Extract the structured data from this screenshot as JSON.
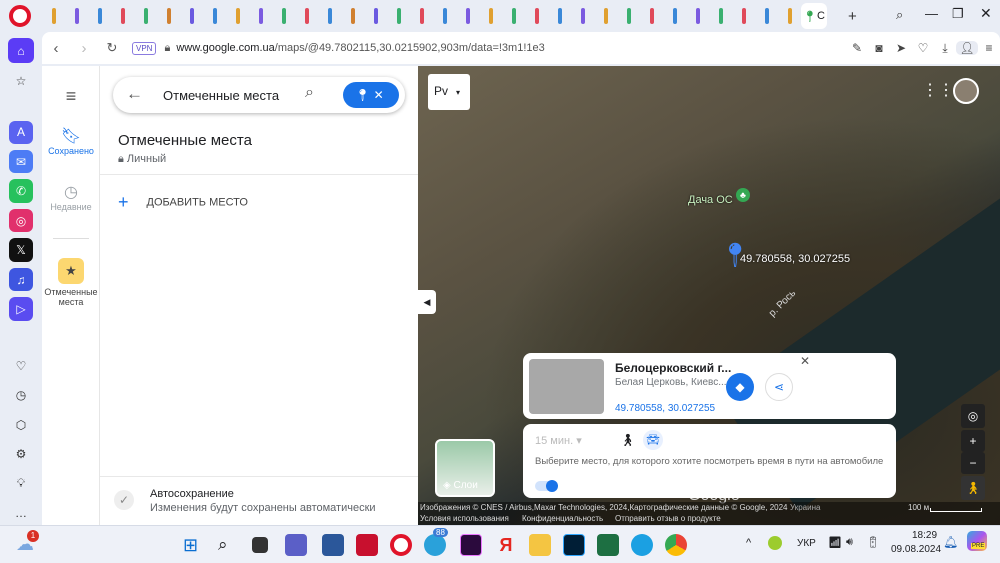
{
  "browser": {
    "active_tab_label": "C",
    "tab_colors": [
      "#e0a030",
      "#7b5be0",
      "#3a88d8",
      "#e04a5a",
      "#3ab070",
      "#d08030",
      "#6a5ae0",
      "#3a88d8",
      "#e0a030",
      "#7b5be0",
      "#3ab070",
      "#e04a5a",
      "#3a88d8",
      "#d08030",
      "#6a5ae0",
      "#3ab070",
      "#e04a5a",
      "#3a88d8",
      "#7b5be0",
      "#e0a030",
      "#3ab070",
      "#e04a5a",
      "#3a88d8",
      "#7b5be0",
      "#e0a030",
      "#3ab070",
      "#e04a5a",
      "#3a88d8",
      "#7b5be0",
      "#3ab070",
      "#e04a5a",
      "#3a88d8",
      "#e0a030"
    ],
    "vpn_label": "VPN",
    "url_domain": "www.google.com.ua",
    "url_path": "/maps/@49.7802115,30.0215902,903m/data=!3m1!1e3"
  },
  "leftnav": {
    "saved": "Сохранено",
    "recent": "Недавние",
    "marked": "Отмеченные места"
  },
  "panel": {
    "search_value": "Отмеченные места",
    "title": "Отмеченные места",
    "privacy": "Личный",
    "add_place": "ДОБАВИТЬ МЕСТО",
    "autosave_title": "Автосохранение",
    "autosave_desc": "Изменения будут сохранены автоматически"
  },
  "map": {
    "type_label": "Рv",
    "poi_label": "Дача ОС",
    "pin_coords": "49.780558, 30.027255",
    "river_label": "р. Рось",
    "layers_label": "Слои",
    "place_card": {
      "name": "Белоцерковский г...",
      "address": "Белая Церковь, Киевс...",
      "coords": "49.780558, 30.027255"
    },
    "travel": {
      "time": "15 мин.",
      "hint": "Выберите место, для которого хотите посмотреть время в пути на автомобиле"
    },
    "attribution": "Изображения © CNES / Airbus,Maxar Technologies, 2024,Картографические данные © Google, 2024",
    "country": "Украина",
    "scale": "100 м",
    "terms": "Условия использования",
    "privacy": "Конфиденциальность",
    "feedback": "Отправить отзыв о продукте",
    "google": "Google"
  },
  "taskbar": {
    "badge_weather": "1",
    "badge_telegram": "88",
    "lang": "УКР",
    "time": "18:29",
    "date": "09.08.2024",
    "copilot": "PRE"
  }
}
